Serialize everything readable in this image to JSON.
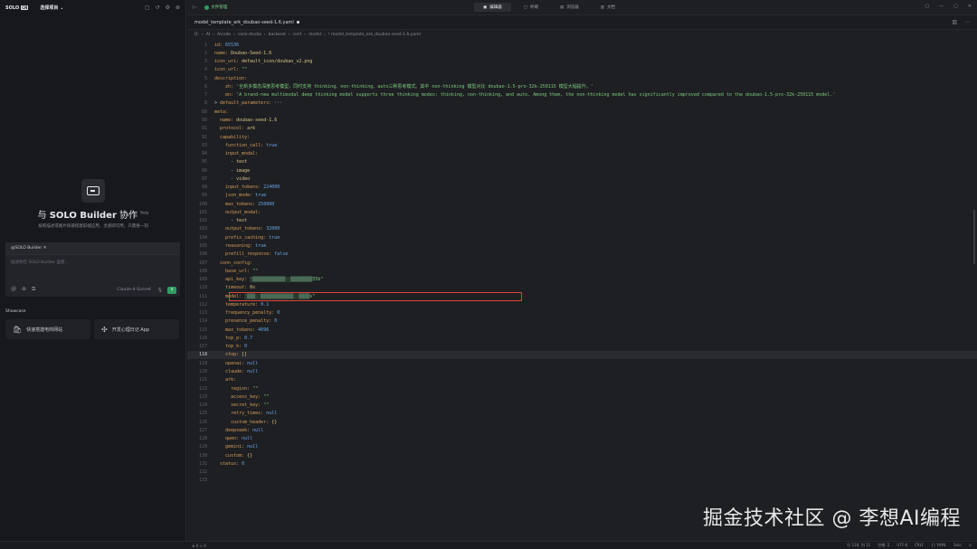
{
  "left": {
    "brand": "SOLO",
    "brand_box": "CN",
    "project": "选择项目",
    "project_caret": "⌄",
    "header_icons": [
      "▢",
      "↺",
      "⚙",
      "⊗"
    ],
    "hero_title_pre": "与",
    "hero_title_bold": "SOLO Builder",
    "hero_title_post": "协作",
    "hero_badge": "Beta",
    "hero_sub": "按照描述或图片快速搭建前端应用，灵感即可用，只需要一刻",
    "chat_tag": "@SOLO Builder ✕",
    "chat_placeholder": "描述你在 SOLO Builder 里想...",
    "chat_tools": [
      "@",
      "⊕",
      "⧉"
    ],
    "chat_model": "Claude-4-Sonnet",
    "chat_mic": "🎙",
    "chat_send": "↑",
    "showcase": "Showcase",
    "cards": [
      {
        "icon": "🛍",
        "label": "快速搭建电商网站"
      },
      {
        "icon": "✣",
        "label": "开发心理日记 App"
      }
    ]
  },
  "topbar": {
    "toggle": "⊢",
    "status": "文件管理",
    "tabs": [
      {
        "icon": "▣",
        "label": "编辑器"
      },
      {
        "icon": "▢",
        "label": "终端"
      },
      {
        "icon": "▤",
        "label": "浏览器"
      },
      {
        "icon": "▥",
        "label": "文档"
      }
    ],
    "window": [
      "▢",
      "—",
      "▢",
      "✕"
    ]
  },
  "file": {
    "name": "model_template_ark_doubao-seed-1.6.yaml",
    "icons": [
      "▥",
      "⋯"
    ],
    "breadcrumb": [
      "D:",
      "AI",
      "Aicode",
      "coze-studio",
      "backend",
      "conf",
      "model",
      "!  model_template_ark_doubao-seed-1.6.yaml"
    ]
  },
  "code": [
    {
      "n": "1",
      "t": [
        [
          "k",
          "id: "
        ],
        [
          "n",
          "65536"
        ]
      ]
    },
    {
      "n": "2",
      "t": [
        [
          "k",
          "name: "
        ],
        [
          "v",
          "Doubao-Seed-1.6"
        ]
      ]
    },
    {
      "n": "3",
      "t": [
        [
          "k",
          "icon_uri: "
        ],
        [
          "v",
          "default_icon/doubao_v2.png"
        ]
      ]
    },
    {
      "n": "4",
      "t": [
        [
          "k",
          "icon_url: "
        ],
        [
          "s",
          "\"\""
        ]
      ]
    },
    {
      "n": "5",
      "t": [
        [
          "k",
          "description:"
        ]
      ]
    },
    {
      "n": "6",
      "t": [
        [
          "c",
          "    "
        ],
        [
          "k",
          "zh: "
        ],
        [
          "s",
          "'全新多模态深度思考模型，同时支持 thinking、non-thinking、auto三种思考模式。其中 non-thinking 模型对比 doubao-1.5-pro-32k-250115 模型大幅提升。'"
        ]
      ]
    },
    {
      "n": "7",
      "t": [
        [
          "c",
          "    "
        ],
        [
          "k",
          "en: "
        ],
        [
          "s",
          "'A brand-new multimodal deep thinking model supports three thinking modes: thinking, non-thinking, and auto. Among them, the non-thinking model has significantly improved compared to the doubao-1.5-pro-32k-250115 model.'"
        ]
      ]
    },
    {
      "n": "8",
      "t": [
        [
          "c",
          "> "
        ],
        [
          "k",
          "default_parameters: "
        ],
        [
          "c",
          "···"
        ]
      ]
    },
    {
      "n": "89",
      "t": [
        [
          "k",
          "meta:"
        ]
      ]
    },
    {
      "n": "90",
      "t": [
        [
          "c",
          "  "
        ],
        [
          "k",
          "name: "
        ],
        [
          "v",
          "doubao-seed-1.6"
        ]
      ]
    },
    {
      "n": "91",
      "t": [
        [
          "c",
          "  "
        ],
        [
          "k",
          "protocol: "
        ],
        [
          "v",
          "ark"
        ]
      ]
    },
    {
      "n": "92",
      "t": [
        [
          "c",
          "  "
        ],
        [
          "k",
          "capability:"
        ]
      ]
    },
    {
      "n": "93",
      "t": [
        [
          "c",
          "    "
        ],
        [
          "k",
          "function_call: "
        ],
        [
          "n",
          "true"
        ]
      ]
    },
    {
      "n": "94",
      "t": [
        [
          "c",
          "    "
        ],
        [
          "k",
          "input_modal:"
        ]
      ]
    },
    {
      "n": "95",
      "t": [
        [
          "c",
          "      - "
        ],
        [
          "v",
          "text"
        ]
      ]
    },
    {
      "n": "96",
      "t": [
        [
          "c",
          "      - "
        ],
        [
          "v",
          "image"
        ]
      ]
    },
    {
      "n": "97",
      "t": [
        [
          "c",
          "      - "
        ],
        [
          "v",
          "video"
        ]
      ]
    },
    {
      "n": "98",
      "t": [
        [
          "c",
          "    "
        ],
        [
          "k",
          "input_tokens: "
        ],
        [
          "n",
          "224000"
        ]
      ]
    },
    {
      "n": "99",
      "t": [
        [
          "c",
          "    "
        ],
        [
          "k",
          "json_mode: "
        ],
        [
          "n",
          "true"
        ]
      ]
    },
    {
      "n": "100",
      "t": [
        [
          "c",
          "    "
        ],
        [
          "k",
          "max_tokens: "
        ],
        [
          "n",
          "256000"
        ]
      ]
    },
    {
      "n": "101",
      "t": [
        [
          "c",
          "    "
        ],
        [
          "k",
          "output_modal:"
        ]
      ]
    },
    {
      "n": "102",
      "t": [
        [
          "c",
          "      - "
        ],
        [
          "v",
          "text"
        ]
      ]
    },
    {
      "n": "103",
      "t": [
        [
          "c",
          "    "
        ],
        [
          "k",
          "output_tokens: "
        ],
        [
          "n",
          "32000"
        ]
      ]
    },
    {
      "n": "104",
      "t": [
        [
          "c",
          "    "
        ],
        [
          "k",
          "prefix_caching: "
        ],
        [
          "n",
          "true"
        ]
      ]
    },
    {
      "n": "105",
      "t": [
        [
          "c",
          "    "
        ],
        [
          "k",
          "reasoning: "
        ],
        [
          "n",
          "true"
        ]
      ]
    },
    {
      "n": "106",
      "t": [
        [
          "c",
          "    "
        ],
        [
          "k",
          "prefill_response: "
        ],
        [
          "n",
          "false"
        ]
      ]
    },
    {
      "n": "107",
      "t": [
        [
          "c",
          "  "
        ],
        [
          "k",
          "conn_config:"
        ]
      ]
    },
    {
      "n": "108",
      "t": [
        [
          "c",
          "    "
        ],
        [
          "k",
          "base_url: "
        ],
        [
          "s",
          "\"\""
        ]
      ]
    },
    {
      "n": "109",
      "t": [
        [
          "c",
          "    "
        ],
        [
          "k",
          "api_key: "
        ],
        [
          "blur",
          "\"████████████  ████████"
        ],
        [
          "s",
          "35b\""
        ]
      ]
    },
    {
      "n": "110",
      "t": [
        [
          "c",
          "    "
        ],
        [
          "k",
          "timeout: "
        ],
        [
          "v",
          "0s"
        ]
      ]
    },
    {
      "n": "111",
      "t": [
        [
          "c",
          "    "
        ],
        [
          "k",
          "model: "
        ],
        [
          "blur",
          "\"███  ████████████  ████"
        ],
        [
          "s",
          "v\""
        ]
      ]
    },
    {
      "n": "112",
      "t": [
        [
          "c",
          "    "
        ],
        [
          "k",
          "temperature: "
        ],
        [
          "n",
          "0.1"
        ]
      ]
    },
    {
      "n": "113",
      "t": [
        [
          "c",
          "    "
        ],
        [
          "k",
          "frequency_penalty: "
        ],
        [
          "n",
          "0"
        ]
      ]
    },
    {
      "n": "114",
      "t": [
        [
          "c",
          "    "
        ],
        [
          "k",
          "presence_penalty: "
        ],
        [
          "n",
          "0"
        ]
      ]
    },
    {
      "n": "115",
      "t": [
        [
          "c",
          "    "
        ],
        [
          "k",
          "max_tokens: "
        ],
        [
          "n",
          "4096"
        ]
      ]
    },
    {
      "n": "116",
      "t": [
        [
          "c",
          "    "
        ],
        [
          "k",
          "top_p: "
        ],
        [
          "n",
          "0.7"
        ]
      ]
    },
    {
      "n": "117",
      "t": [
        [
          "c",
          "    "
        ],
        [
          "k",
          "top_k: "
        ],
        [
          "n",
          "0"
        ]
      ]
    },
    {
      "n": "118",
      "t": [
        [
          "c",
          "    "
        ],
        [
          "k",
          "stop: "
        ],
        [
          "v",
          "[]"
        ]
      ]
    },
    {
      "n": "119",
      "t": [
        [
          "c",
          "    "
        ],
        [
          "k",
          "openai: "
        ],
        [
          "n",
          "null"
        ]
      ]
    },
    {
      "n": "120",
      "t": [
        [
          "c",
          "    "
        ],
        [
          "k",
          "claude: "
        ],
        [
          "n",
          "null"
        ]
      ]
    },
    {
      "n": "121",
      "t": [
        [
          "c",
          "    "
        ],
        [
          "k",
          "ark:"
        ]
      ]
    },
    {
      "n": "122",
      "t": [
        [
          "c",
          "      "
        ],
        [
          "k",
          "region: "
        ],
        [
          "s",
          "\"\""
        ]
      ]
    },
    {
      "n": "123",
      "t": [
        [
          "c",
          "      "
        ],
        [
          "k",
          "access_key: "
        ],
        [
          "s",
          "\"\""
        ]
      ]
    },
    {
      "n": "124",
      "t": [
        [
          "c",
          "      "
        ],
        [
          "k",
          "secret_key: "
        ],
        [
          "s",
          "\"\""
        ]
      ]
    },
    {
      "n": "125",
      "t": [
        [
          "c",
          "      "
        ],
        [
          "k",
          "retry_times: "
        ],
        [
          "n",
          "null"
        ]
      ]
    },
    {
      "n": "126",
      "t": [
        [
          "c",
          "      "
        ],
        [
          "k",
          "custom_header: "
        ],
        [
          "v",
          "{}"
        ]
      ]
    },
    {
      "n": "127",
      "t": [
        [
          "c",
          "    "
        ],
        [
          "k",
          "deepseek: "
        ],
        [
          "n",
          "null"
        ]
      ]
    },
    {
      "n": "128",
      "t": [
        [
          "c",
          "    "
        ],
        [
          "k",
          "qwen: "
        ],
        [
          "n",
          "null"
        ]
      ]
    },
    {
      "n": "129",
      "t": [
        [
          "c",
          "    "
        ],
        [
          "k",
          "gemini: "
        ],
        [
          "n",
          "null"
        ]
      ]
    },
    {
      "n": "130",
      "t": [
        [
          "c",
          "    "
        ],
        [
          "k",
          "custom: "
        ],
        [
          "v",
          "{}"
        ]
      ]
    },
    {
      "n": "131",
      "t": [
        [
          "c",
          "  "
        ],
        [
          "k",
          "status: "
        ],
        [
          "n",
          "0"
        ]
      ]
    },
    {
      "n": "132",
      "t": []
    },
    {
      "n": "133",
      "t": []
    }
  ],
  "current_line": "118",
  "watermark": "掘金技术社区 @ 李想AI编程",
  "status": {
    "left": "⊗ 0 ⚠ 0",
    "right": [
      "行 118, 列 11",
      "空格: 2",
      "UTF-8",
      "CRLF",
      "{} YAML",
      "Solo",
      "⊙"
    ]
  }
}
